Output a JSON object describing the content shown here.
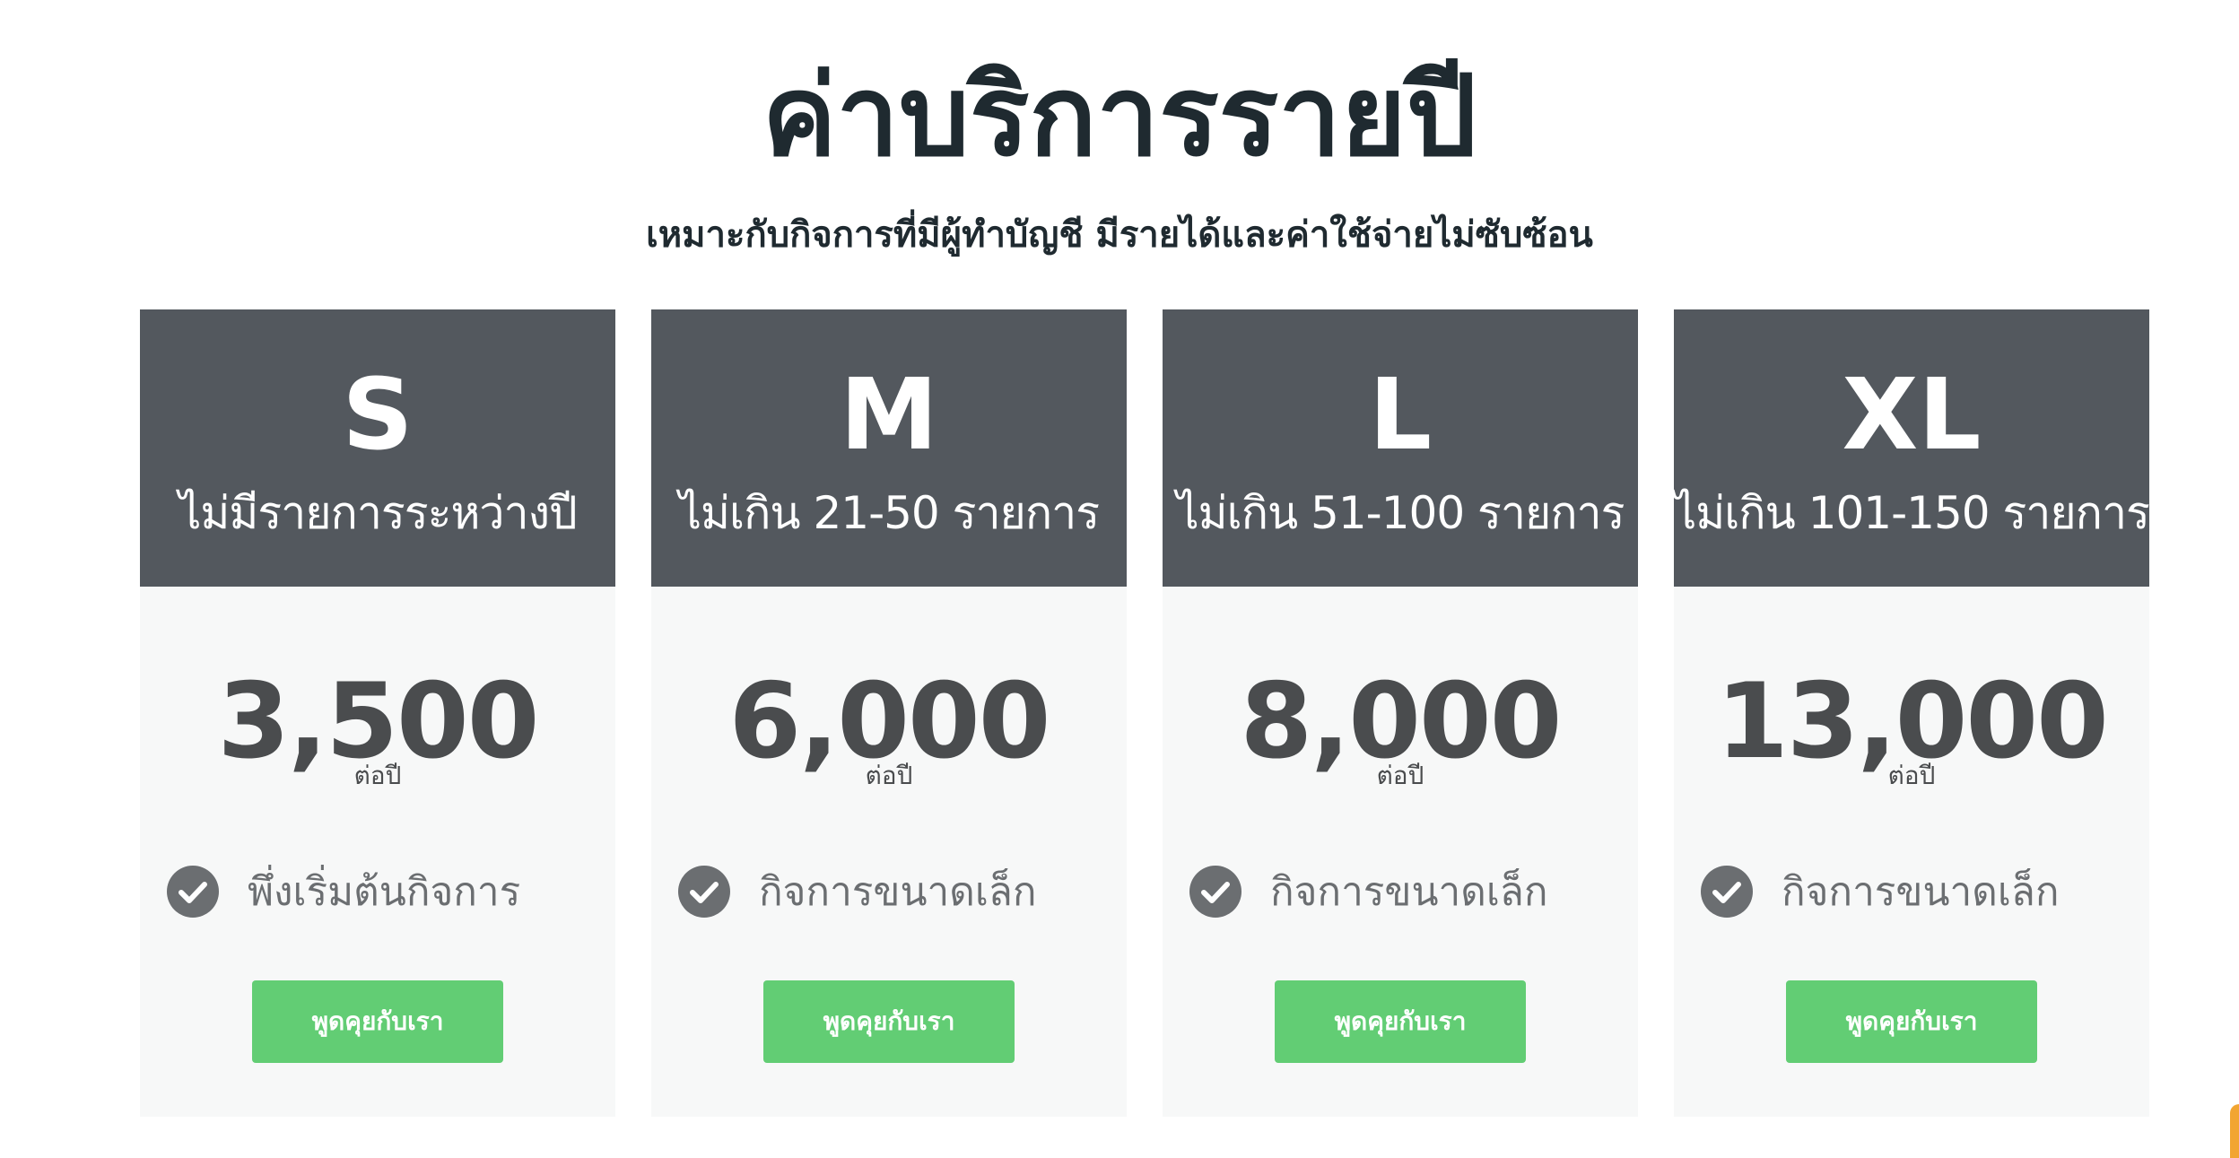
{
  "header": {
    "title": "ค่าบริการรายปี",
    "subtitle": "เหมาะกับกิจการที่มีผู้ทำบัญชี มีรายได้และค่าใช้จ่ายไม่ซับซ้อน"
  },
  "plans": [
    {
      "size": "S",
      "range": "ไม่มีรายการระหว่างปี",
      "price": "3,500",
      "period": "ต่อปี",
      "feature": "พึ่งเริ่มต้นกิจการ",
      "button_label": "พูดคุยกับเรา"
    },
    {
      "size": "M",
      "range": "ไม่เกิน 21-50 รายการ",
      "price": "6,000",
      "period": "ต่อปี",
      "feature": "กิจการขนาดเล็ก",
      "button_label": "พูดคุยกับเรา"
    },
    {
      "size": "L",
      "range": "ไม่เกิน 51-100 รายการ",
      "price": "8,000",
      "period": "ต่อปี",
      "feature": "กิจการขนาดเล็ก",
      "button_label": "พูดคุยกับเรา"
    },
    {
      "size": "XL",
      "range": "ไม่เกิน 101-150 รายการ",
      "price": "13,000",
      "period": "ต่อปี",
      "feature": "กิจการขนาดเล็ก",
      "button_label": "พูดคุยกับเรา"
    }
  ],
  "icons": {
    "feature": "check-circle-icon"
  },
  "colors": {
    "header_bg": "#53585e",
    "card_bg": "#f7f8f8",
    "button_bg": "#62cd74",
    "title_text": "#1f2a30",
    "price_text": "#4a4c4e",
    "check_bg": "#6b6e71"
  }
}
